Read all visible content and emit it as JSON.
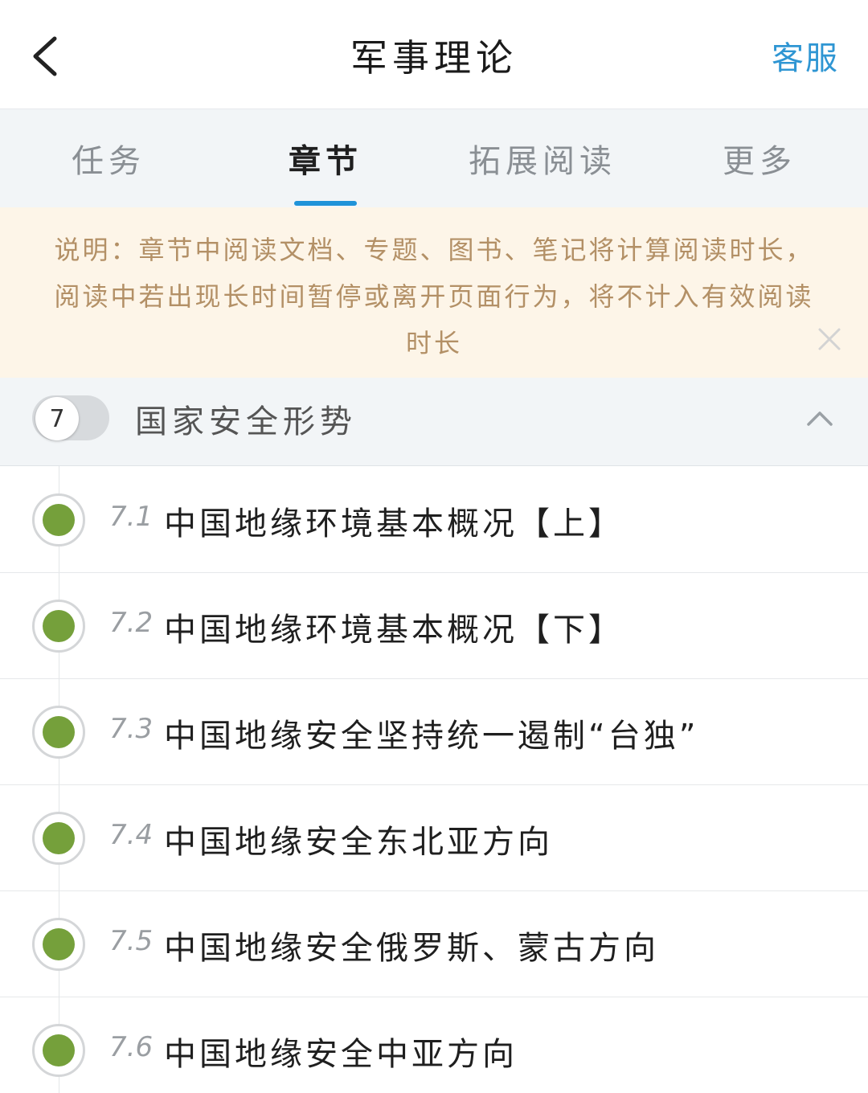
{
  "header": {
    "title": "军事理论",
    "service_label": "客服"
  },
  "tabs": [
    {
      "label": "任务",
      "active": false
    },
    {
      "label": "章节",
      "active": true
    },
    {
      "label": "拓展阅读",
      "active": false
    },
    {
      "label": "更多",
      "active": false
    }
  ],
  "notice": {
    "text": "说明：章节中阅读文档、专题、图书、笔记将计算阅读时长，阅读中若出现长时间暂停或离开页面行为，将不计入有效阅读时长"
  },
  "chapter": {
    "number": "7",
    "title": "国家安全形势"
  },
  "sections": [
    {
      "number": "7.1",
      "title": "中国地缘环境基本概况【上】",
      "completed": true
    },
    {
      "number": "7.2",
      "title": "中国地缘环境基本概况【下】",
      "completed": true
    },
    {
      "number": "7.3",
      "title": "中国地缘安全坚持统一遏制“台独”",
      "completed": true
    },
    {
      "number": "7.4",
      "title": "中国地缘安全东北亚方向",
      "completed": true
    },
    {
      "number": "7.5",
      "title": "中国地缘安全俄罗斯、蒙古方向",
      "completed": true
    },
    {
      "number": "7.6",
      "title": "中国地缘安全中亚方向",
      "completed": true
    }
  ],
  "colors": {
    "accent": "#1f93d9",
    "service": "#2f96d3",
    "completed_dot": "#75a03b",
    "notice_bg": "#fdf5e8",
    "notice_text": "#b39066"
  },
  "icons": {
    "back": "chevron-left-icon",
    "close": "close-icon",
    "collapse": "chevron-up-icon"
  }
}
